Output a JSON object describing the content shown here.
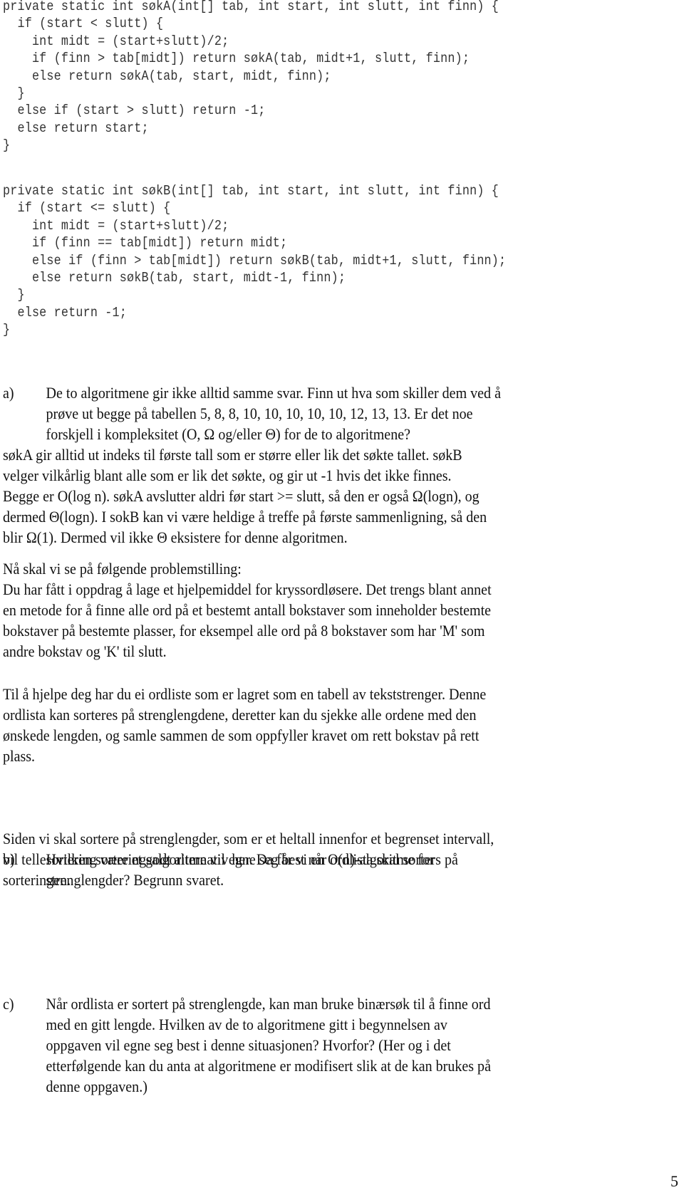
{
  "code": {
    "sokA": [
      "private static int søkA(int[] tab, int start, int slutt, int finn) {",
      "  if (start < slutt) {",
      "    int midt = (start+slutt)/2;",
      "    if (finn > tab[midt]) return søkA(tab, midt+1, slutt, finn);",
      "    else return søkA(tab, start, midt, finn);",
      "  }",
      "  else if (start > slutt) return -1;",
      "  else return start;",
      "}"
    ],
    "sokB": [
      "private static int søkB(int[] tab, int start, int slutt, int finn) {",
      "  if (start <= slutt) {",
      "    int midt = (start+slutt)/2;",
      "    if (finn == tab[midt]) return midt;",
      "    else if (finn > tab[midt]) return søkB(tab, midt+1, slutt, finn);",
      "    else return søkB(tab, start, midt-1, finn);",
      "  }",
      "  else return -1;",
      "}"
    ]
  },
  "question_a": {
    "marker": "a)",
    "lines": [
      "De to algoritmene gir ikke alltid samme svar. Finn ut hva som skiller dem ved å",
      "prøve ut begge på tabellen 5, 8, 8, 10, 10, 10, 10, 10, 12, 13, 13. Er det noe",
      "forskjell i kompleksitet (O, Ω og/eller Θ) for de to algoritmene?"
    ]
  },
  "answer_a": {
    "lines": [
      "søkA gir alltid ut indeks til første tall som er større eller lik det søkte tallet. søkB",
      "velger vilkårlig blant alle som er lik det søkte, og gir ut -1 hvis det ikke finnes.",
      "Begge er O(log n). søkA avslutter aldri før start >= slutt, så den er også Ω(logn), og",
      "dermed Θ(logn). I sokB kan vi være heldige å treffe på første sammenligning, så den",
      "blir Ω(1). Dermed vil ikke Θ eksistere for denne algoritmen."
    ]
  },
  "problem": {
    "intro": "Nå skal vi se på følgende problemstilling:",
    "lines": [
      "Du har fått i oppdrag å lage et hjelpemiddel for kryssordløsere. Det trengs blant annet",
      "en metode for å finne alle ord på et bestemt antall bokstaver som inneholder bestemte",
      "bokstaver på bestemte plasser, for eksempel alle ord på 8 bokstaver som har 'M' som",
      "andre bokstav og 'K' til slutt."
    ]
  },
  "hint": {
    "lines": [
      "Til å hjelpe deg har du ei ordliste som er lagret som en tabell av tekststrenger. Denne",
      "ordlista kan sorteres på strenglengdene, deretter kan du sjekke alle ordene med den",
      "ønskede lengden, og samle sammen de som oppfyller kravet om rett bokstav på rett",
      "plass."
    ]
  },
  "question_b": {
    "marker": "b)",
    "lines": [
      "Hvilken sorteringsalgoritme vil egne seg best når ordlista skal sorters på",
      "strenglengder? Begrunn svaret."
    ]
  },
  "answer_b": {
    "lines": [
      "Siden vi skal sortere på strenglengder, som er et heltall innenfor et begrenset intervall,",
      "vil tellesortering være et godt alternativ her. Da får vi en O(n)-algoritme for",
      "sorteringen."
    ]
  },
  "question_c": {
    "marker": "c)",
    "lines": [
      "Når ordlista er sortert på strenglengde, kan man bruke binærsøk til å finne ord",
      "med en gitt lengde. Hvilken av de to algoritmene gitt i begynnelsen av",
      "oppgaven vil egne seg best i denne situasjonen? Hvorfor? (Her og i det",
      "etterfølgende kan du anta at algoritmene er modifisert slik at de kan brukes på",
      "denne oppgaven.)"
    ]
  },
  "page_number": "5"
}
